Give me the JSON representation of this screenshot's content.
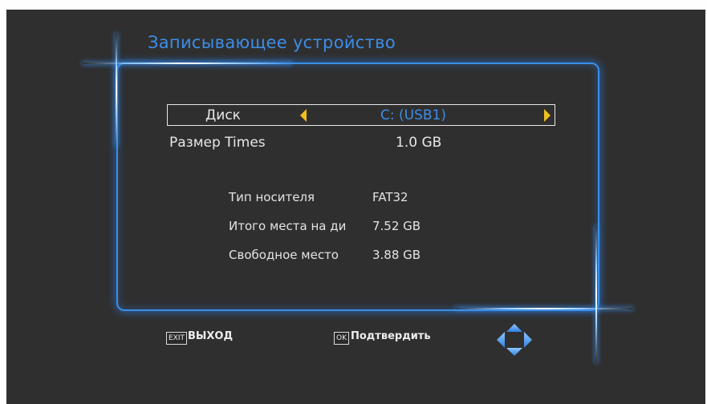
{
  "title": "Записывающее устройство",
  "disk_row": {
    "label": "Диск",
    "value": "C: (USB1)"
  },
  "size_row": {
    "label": "Размер Times",
    "value": "1.0 GB"
  },
  "info": [
    {
      "label": "Тип носителя",
      "value": "FAT32"
    },
    {
      "label": "Итого места на ди",
      "value": "7.52 GB"
    },
    {
      "label": "Свободное место",
      "value": "3.88 GB"
    }
  ],
  "footer": {
    "exit_key": "EXIT",
    "exit_label": "ВЫХОД",
    "ok_key": "OK",
    "ok_label": "Подтвердить"
  },
  "colors": {
    "background": "#2f2f2f",
    "accent_blue": "#3d8de8",
    "arrow_yellow": "#f0c020",
    "text": "#e8e8e8"
  },
  "icons": {
    "left_arrow": "triangle-left-icon",
    "right_arrow": "triangle-right-icon",
    "navigation": "navigation-arrows-icon"
  }
}
